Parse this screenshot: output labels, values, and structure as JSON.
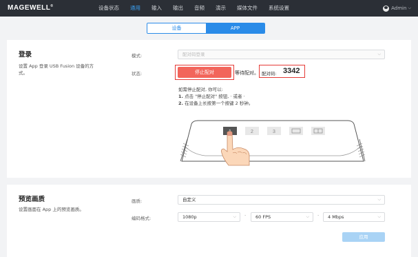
{
  "brand": {
    "logo_text": "MAGEWELL",
    "logo_mark": "®"
  },
  "nav": {
    "items": [
      "设备状态",
      "通用",
      "输入",
      "输出",
      "音频",
      "演示",
      "媒体文件",
      "系统设置"
    ],
    "active_index": 1
  },
  "user": {
    "name": "Admin",
    "chevron": "⌵"
  },
  "tabs": {
    "device": "设备",
    "app": "APP",
    "active": "APP"
  },
  "login": {
    "title": "登录",
    "desc_line1": "设置 App 登录 USB Fusion 设备的方",
    "desc_line2": "式。",
    "mode_label": "模式:",
    "mode_value": "配对码登录",
    "status_label": "状态:",
    "stop_button": "停止配对",
    "waiting_text": "等待配对。",
    "code_label": "配对码:",
    "code_value": "3342",
    "instr_line1": "如需停止配对, 你可以:",
    "instr_num1": "1.",
    "instr_line2": "点击 \"停止配对\" 按钮, · 或者 ·",
    "instr_num2": "2.",
    "instr_line3": "在设备上长按第一个按键 2 秒钟。",
    "device_buttons": [
      "1",
      "2",
      "3"
    ]
  },
  "preview": {
    "title": "预览画质",
    "desc": "设置画面在 App 上的预览画质。",
    "quality_label": "画质:",
    "quality_value": "自定义",
    "encode_label": "编码格式:",
    "resolution": "1080p",
    "fps": "60 FPS",
    "bitrate": "4 Mbps",
    "separator": "·",
    "apply_button": "应用"
  },
  "colors": {
    "accent": "#2a8be8",
    "danger": "#e53935",
    "stop": "#f2655b",
    "topbar": "#2b2f36"
  }
}
